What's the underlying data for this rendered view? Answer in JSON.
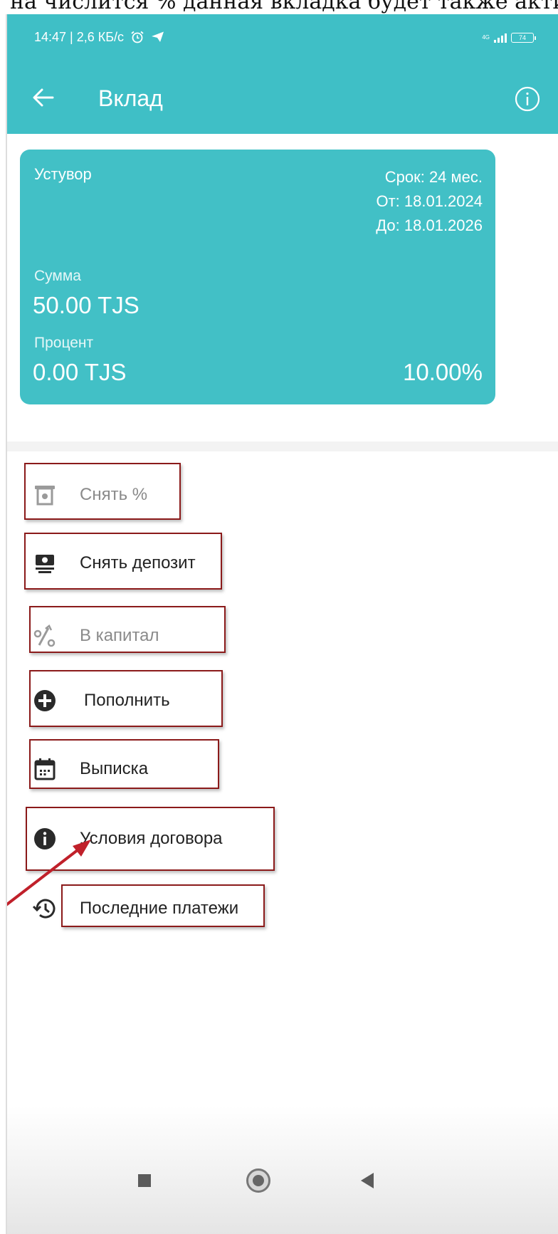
{
  "caption": "на числится % данная вкладка будет также активн",
  "status_bar": {
    "time": "14:47 | 2,6 КБ/с",
    "network": "4G",
    "battery": "74",
    "icons": [
      "alarm-icon",
      "telegram-icon",
      "signal-icon",
      "battery-icon"
    ]
  },
  "header": {
    "title": "Вклад",
    "back_icon": "arrow-left-icon",
    "info_icon": "info-circle-icon"
  },
  "deposit": {
    "name": "Устувор",
    "term": "Срок: 24 мес.",
    "from": "От: 18.01.2024",
    "to": "До: 18.01.2026",
    "sum_label": "Сумма",
    "sum": "50.00 TJS",
    "percent_label": "Процент",
    "percent": "0.00 TJS",
    "rate": "10.00%"
  },
  "actions": [
    {
      "label": "Снять %",
      "icon": "atm-withdraw-icon",
      "enabled": false
    },
    {
      "label": "Снять депозит",
      "icon": "cash-withdraw-icon",
      "enabled": true
    },
    {
      "label": "В капитал",
      "icon": "percent-up-icon",
      "enabled": false
    },
    {
      "label": "Пополнить",
      "icon": "plus-circle-icon",
      "enabled": true
    },
    {
      "label": "Выписка",
      "icon": "calendar-icon",
      "enabled": true
    },
    {
      "label": "Условия договора",
      "icon": "info-filled-icon",
      "enabled": true
    },
    {
      "label": "Последние платежи",
      "icon": "history-icon",
      "enabled": true
    }
  ],
  "colors": {
    "primary": "#3fbfc6",
    "card": "#42c0c6",
    "highlight_frame": "#8b1a1a",
    "annotation_arrow": "#c0202a",
    "disabled_text": "#8a8a8a"
  },
  "navigation": [
    "recent-apps-icon",
    "home-icon",
    "back-icon"
  ]
}
